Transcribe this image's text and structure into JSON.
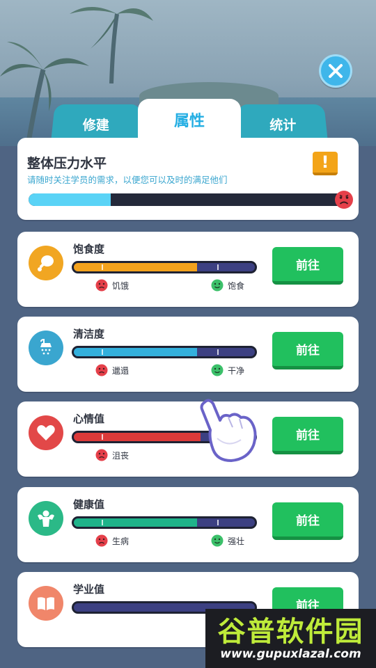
{
  "tabs": [
    {
      "label": "修建",
      "active": false
    },
    {
      "label": "属性",
      "active": true
    },
    {
      "label": "统计",
      "active": false
    }
  ],
  "overall": {
    "title": "整体压力水平",
    "subtitle": "请随时关注学员的需求，以便您可以及时的满足他们",
    "level": 0.26,
    "warning_icon": "exclamation-icon",
    "face": "sad-face-icon"
  },
  "attributes": [
    {
      "id": "satiety",
      "name": "饱食度",
      "icon": "drumstick-icon",
      "icon_color": "#f1a622",
      "fill_color": "#f3a21d",
      "fill": 0.68,
      "low_label": "饥饿",
      "high_label": "饱食",
      "button": "前往"
    },
    {
      "id": "cleanliness",
      "name": "清洁度",
      "icon": "shower-icon",
      "icon_color": "#3aa6cf",
      "fill_color": "#33b0dd",
      "fill": 0.68,
      "low_label": "邋遢",
      "high_label": "干净",
      "button": "前往"
    },
    {
      "id": "mood",
      "name": "心情值",
      "icon": "heart-icon",
      "icon_color": "#e24848",
      "fill_color": "#dc3a3a",
      "fill": 0.7,
      "low_label": "沮丧",
      "high_label": "",
      "button": "前往"
    },
    {
      "id": "health",
      "name": "健康值",
      "icon": "muscle-icon",
      "icon_color": "#2bb987",
      "fill_color": "#1fb38a",
      "fill": 0.68,
      "low_label": "生病",
      "high_label": "强壮",
      "button": "前往"
    },
    {
      "id": "study",
      "name": "学业值",
      "icon": "book-icon",
      "icon_color": "#f0866a",
      "fill_color": "#3c4082",
      "fill": 0.0,
      "low_label": "",
      "high_label": "",
      "button": "前往"
    }
  ],
  "watermark": {
    "title": "谷普软件园",
    "url": "www.gupuxlazal.com"
  }
}
